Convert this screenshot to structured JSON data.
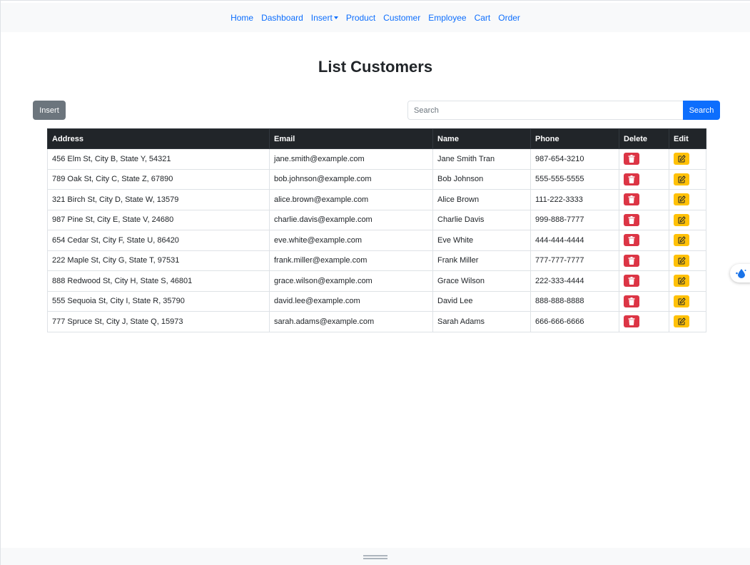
{
  "nav": {
    "items": [
      "Home",
      "Dashboard",
      "Insert",
      "Product",
      "Customer",
      "Employee",
      "Cart",
      "Order"
    ]
  },
  "page": {
    "title": "List Customers"
  },
  "toolbar": {
    "insert_label": "Insert",
    "search_placeholder": "Search",
    "search_label": "Search"
  },
  "table": {
    "headers": [
      "Address",
      "Email",
      "Name",
      "Phone",
      "Delete",
      "Edit"
    ],
    "rows": [
      [
        "456 Elm St, City B, State Y, 54321",
        "jane.smith@example.com",
        "Jane Smith Tran",
        "987-654-3210"
      ],
      [
        "789 Oak St, City C, State Z, 67890",
        "bob.johnson@example.com",
        "Bob Johnson",
        "555-555-5555"
      ],
      [
        "321 Birch St, City D, State W, 13579",
        "alice.brown@example.com",
        "Alice Brown",
        "111-222-3333"
      ],
      [
        "987 Pine St, City E, State V, 24680",
        "charlie.davis@example.com",
        "Charlie Davis",
        "999-888-7777"
      ],
      [
        "654 Cedar St, City F, State U, 86420",
        "eve.white@example.com",
        "Eve White",
        "444-444-4444"
      ],
      [
        "222 Maple St, City G, State T, 97531",
        "frank.miller@example.com",
        "Frank Miller",
        "777-777-7777"
      ],
      [
        "888 Redwood St, City H, State S, 46801",
        "grace.wilson@example.com",
        "Grace Wilson",
        "222-333-4444"
      ],
      [
        "555 Sequoia St, City I, State R, 35790",
        "david.lee@example.com",
        "David Lee",
        "888-888-8888"
      ],
      [
        "777 Spruce St, City J, State Q, 15973",
        "sarah.adams@example.com",
        "Sarah Adams",
        "666-666-6666"
      ]
    ]
  },
  "colors": {
    "link": "#0d6efd",
    "delete": "#dc3545",
    "edit": "#ffc107",
    "header": "#212529"
  },
  "icons": {
    "delete": "trash-icon",
    "edit": "pencil-square-icon",
    "widget": "water-drop-icon"
  }
}
